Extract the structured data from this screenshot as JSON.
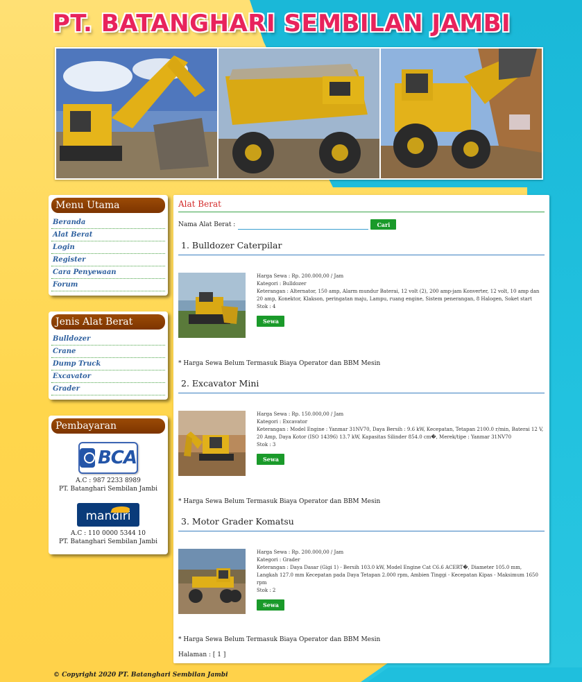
{
  "header": {
    "site_title": "PT. BATANGHARI SEMBILAN JAMBI"
  },
  "sidebar": {
    "main_menu": {
      "title": "Menu Utama",
      "items": [
        "Beranda",
        "Alat Berat",
        "Login",
        "Register",
        "Cara Penyewaan",
        "Forum"
      ]
    },
    "categories": {
      "title": "Jenis Alat Berat",
      "items": [
        "Bulldozer",
        "Crane",
        "Dump Truck",
        "Excavator",
        "Grader"
      ]
    },
    "payment": {
      "title": "Pembayaran",
      "bca_logo_text": "BCA",
      "bca_account": "A.C : 987 2233 8989",
      "bca_name": "PT. Batanghari Sembilan Jambi",
      "mandiri_logo_text": "mandiri",
      "mandiri_account": "A.C : 110 0000 5344 10",
      "mandiri_name": "PT. Batanghari Sembilan Jambi"
    }
  },
  "main": {
    "title": "Alat Berat",
    "search": {
      "label": "Nama Alat Berat :",
      "value": "",
      "button": "Cari"
    },
    "products": [
      {
        "title": "1. Bulldozer Caterpilar",
        "price": "Harga Sewa : Rp. 200.000,00 / Jam",
        "category": "Kategori : Bulldozer",
        "description": "Keterangan : Alternator, 150 amp, Alarm mundur Baterai, 12 volt (2), 200 amp-jam Konverter, 12 volt, 10 amp dan 20 amp, Konektor, Klakson, peringatan maju, Lampu, ruang engine, Sistem penerangan, 8 Halogen, Soket start",
        "stock": "Stok : 4",
        "button": "Sewa",
        "note": "* Harga Sewa Belum Termasuk Biaya Operator dan BBM Mesin"
      },
      {
        "title": "2. Excavator Mini",
        "price": "Harga Sewa : Rp. 150.000,00 / Jam",
        "category": "Kategori : Excavator",
        "description": "Keterangan : Model Engine : Yanmar 31NV70, Daya Bersih : 9.6 kW, Kecepatan, Tetapan 2100.0 r/min, Baterai 12 V, 20 Amp, Daya Kotor (ISO 14396) 13.7 kW, Kapasitas Silinder 854.0 cm�, Merek/tipe : Yanmar 31NV70",
        "stock": "Stok : 3",
        "button": "Sewa",
        "note": "* Harga Sewa Belum Termasuk Biaya Operator dan BBM Mesin"
      },
      {
        "title": "3. Motor Grader Komatsu",
        "price": "Harga Sewa : Rp. 200.000,00 / Jam",
        "category": "Kategori : Grader",
        "description": "Keterangan : Daya Dasar (Gigi 1) - Bersih 103.0 kW, Model Engine Cat C6.6 ACERT�, Diameter 105.0 mm, Langkah 127.0 mm Kecepatan pada Daya Tetapan 2.000 rpm, Ambien Tinggi - Kecepatan Kipas - Maksimum 1650 rpm",
        "stock": "Stok : 2",
        "button": "Sewa",
        "note": "* Harga Sewa Belum Termasuk Biaya Operator dan BBM Mesin"
      }
    ],
    "pagination": "Halaman : [ 1 ]"
  },
  "footer": {
    "copyright": "© Copyright 2020 PT. Batanghari Sembilan Jambi"
  },
  "colors": {
    "accent_red": "#d32a2a",
    "menu_header": "#8a3d00",
    "button_green": "#1a9a2a",
    "bg_yellow": "#ffd84a",
    "bg_cyan": "#1ab8d8"
  }
}
